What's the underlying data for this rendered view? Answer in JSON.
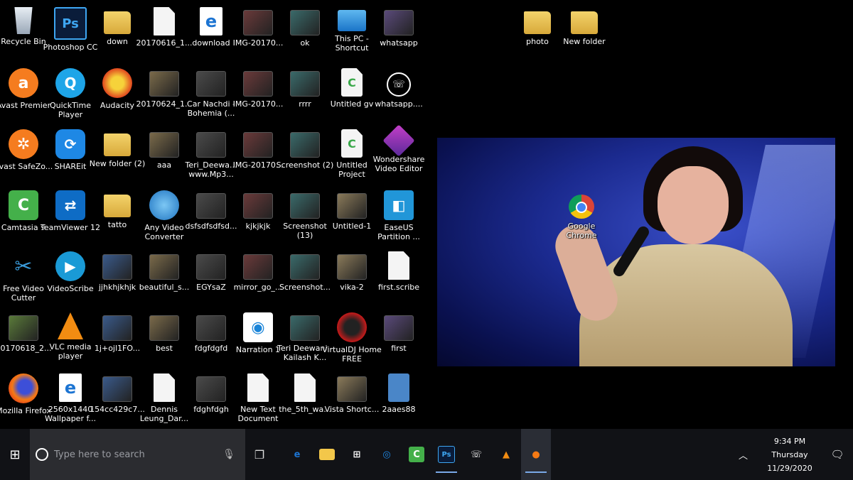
{
  "desktop": {
    "icons": [
      {
        "label": "Recycle Bin",
        "icon": "recycle-bin-icon"
      },
      {
        "label": "Photoshop CC",
        "icon": "photoshop-icon"
      },
      {
        "label": "down",
        "icon": "folder-icon"
      },
      {
        "label": "20170616_1...",
        "icon": "file-icon"
      },
      {
        "label": "download",
        "icon": "edge-file-icon"
      },
      {
        "label": "IMG-20170...",
        "icon": "image-icon"
      },
      {
        "label": "ok",
        "icon": "image-icon"
      },
      {
        "label": "This PC - Shortcut",
        "icon": "this-pc-icon"
      },
      {
        "label": "whatsapp",
        "icon": "image-icon"
      },
      {
        "label": "Avast Premier",
        "icon": "avast-icon"
      },
      {
        "label": "QuickTime Player",
        "icon": "quicktime-icon"
      },
      {
        "label": "Audacity",
        "icon": "audacity-icon"
      },
      {
        "label": "20170624_1...",
        "icon": "video-icon"
      },
      {
        "label": "Car Nachdi - Bohemia (...",
        "icon": "image-icon"
      },
      {
        "label": "IMG-20170...",
        "icon": "image-icon"
      },
      {
        "label": "rrrr",
        "icon": "image-icon"
      },
      {
        "label": "Untitled gv",
        "icon": "camtasia-file-icon"
      },
      {
        "label": "whatsapp....",
        "icon": "whatsapp-icon"
      },
      {
        "label": "Avast SafeZo...",
        "icon": "avast-safezone-icon"
      },
      {
        "label": "SHAREit",
        "icon": "shareit-icon"
      },
      {
        "label": "New folder (2)",
        "icon": "folder-icon"
      },
      {
        "label": "aaa",
        "icon": "image-icon"
      },
      {
        "label": "Teri_Deewa... www.Mp3...",
        "icon": "image-icon"
      },
      {
        "label": "IMG-20170...",
        "icon": "image-icon"
      },
      {
        "label": "Screenshot (2)",
        "icon": "image-icon"
      },
      {
        "label": "Untitled Project",
        "icon": "camtasia-file-icon"
      },
      {
        "label": "Wondershare Video Editor",
        "icon": "wondershare-icon"
      },
      {
        "label": "Camtasia 9",
        "icon": "camtasia-icon"
      },
      {
        "label": "TeamViewer 12",
        "icon": "teamviewer-icon"
      },
      {
        "label": "tatto",
        "icon": "folder-icon"
      },
      {
        "label": "Any Video Converter",
        "icon": "any-video-converter-icon"
      },
      {
        "label": "dsfsdfsdfsd...",
        "icon": "image-icon"
      },
      {
        "label": "kjkjkjk",
        "icon": "image-icon"
      },
      {
        "label": "Screenshot (13)",
        "icon": "image-icon"
      },
      {
        "label": "Untitled-1",
        "icon": "image-icon"
      },
      {
        "label": "EaseUS Partition ...",
        "icon": "easeus-icon"
      },
      {
        "label": "Free Video Cutter",
        "icon": "scissors-icon"
      },
      {
        "label": "VideoScribe",
        "icon": "videoscribe-icon"
      },
      {
        "label": "jjhkhjkhjk",
        "icon": "image-icon"
      },
      {
        "label": "beautiful_s...",
        "icon": "image-icon"
      },
      {
        "label": "EGYsaZ",
        "icon": "image-icon"
      },
      {
        "label": "mirror_go_...",
        "icon": "image-icon"
      },
      {
        "label": "Screenshot...",
        "icon": "image-icon"
      },
      {
        "label": "vika-2",
        "icon": "image-icon"
      },
      {
        "label": "first.scribe",
        "icon": "file-icon"
      },
      {
        "label": "20170618_2...",
        "icon": "video-icon"
      },
      {
        "label": "VLC media player",
        "icon": "vlc-icon"
      },
      {
        "label": "1j+ojl1FO...",
        "icon": "image-icon"
      },
      {
        "label": "best",
        "icon": "image-icon"
      },
      {
        "label": "fdgfdgfd",
        "icon": "image-icon"
      },
      {
        "label": "Narration 1",
        "icon": "narration-icon"
      },
      {
        "label": "Teri Deewani - Kailash K...",
        "icon": "image-icon"
      },
      {
        "label": "VirtualDJ Home FREE",
        "icon": "virtualdj-icon"
      },
      {
        "label": "first",
        "icon": "video-icon"
      },
      {
        "label": "Mozilla Firefox",
        "icon": "firefox-icon"
      },
      {
        "label": "2560x1440 Wallpaper f...",
        "icon": "edge-file-icon"
      },
      {
        "label": "154cc429c7...",
        "icon": "image-icon"
      },
      {
        "label": "Dennis Leung_Dar...",
        "icon": "file-icon"
      },
      {
        "label": "fdghfdgh",
        "icon": "image-icon"
      },
      {
        "label": "New Text Document",
        "icon": "text-document-icon"
      },
      {
        "label": "the_5th_wa...",
        "icon": "file-icon"
      },
      {
        "label": "Vista Shortc...",
        "icon": "image-icon"
      },
      {
        "label": "2aaes88",
        "icon": "zip-icon"
      },
      {
        "label": "photo",
        "icon": "folder-icon"
      },
      {
        "label": "New folder",
        "icon": "folder-icon"
      }
    ],
    "chrome": {
      "label": "Google Chrome",
      "icon": "chrome-icon"
    }
  },
  "taskbar": {
    "search_placeholder": "Type here to search",
    "pinned": [
      {
        "name": "edge",
        "icon": "edge-icon",
        "glyph": "e",
        "color": "#1c74d2"
      },
      {
        "name": "file-explorer",
        "icon": "folder-icon",
        "glyph": "",
        "color": "#f3c74a"
      },
      {
        "name": "store",
        "icon": "store-icon",
        "glyph": "⊞",
        "color": "#ffffff"
      },
      {
        "name": "shareit",
        "icon": "shareit-icon",
        "glyph": "◎",
        "color": "#1e88e5"
      },
      {
        "name": "camtasia",
        "icon": "camtasia-icon",
        "glyph": "C",
        "color": "#44b04a"
      },
      {
        "name": "photoshop",
        "icon": "photoshop-icon",
        "glyph": "Ps",
        "color": "#3ea6f2",
        "running": true
      },
      {
        "name": "whatsapp",
        "icon": "whatsapp-icon",
        "glyph": "☏",
        "color": "#ffffff"
      },
      {
        "name": "vlc",
        "icon": "vlc-icon",
        "glyph": "▲",
        "color": "#f28c12"
      },
      {
        "name": "firefox",
        "icon": "firefox-icon",
        "glyph": "●",
        "color": "#f57a14",
        "running": true,
        "active": true
      }
    ],
    "clock": {
      "time": "9:34 PM",
      "day": "Thursday",
      "date": "11/29/2020"
    }
  }
}
